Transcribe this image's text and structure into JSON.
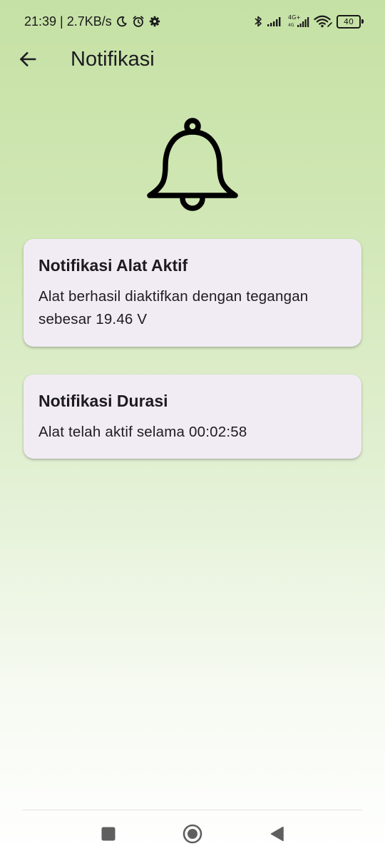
{
  "status_bar": {
    "time_speed": "21:39 | 2.7KB/s",
    "network_label_top": "4G+",
    "network_label_bottom": "4G",
    "battery_level": "40",
    "icons": [
      "moon-icon",
      "alarm-icon",
      "settings-icon",
      "bluetooth-icon",
      "signal-icon",
      "signal-icon",
      "wifi-icon",
      "battery-icon"
    ]
  },
  "app_bar": {
    "title": "Notifikasi",
    "back_icon": "arrow-left-icon"
  },
  "header_icon": "bell-icon",
  "notifications": [
    {
      "title": "Notifikasi Alat Aktif",
      "body": "Alat berhasil diaktifkan dengan tegangan sebesar 19.46 V"
    },
    {
      "title": "Notifikasi Durasi",
      "body": "Alat telah aktif selama 00:02:58"
    }
  ],
  "nav_bar": {
    "icons": [
      "recents-icon",
      "home-icon",
      "back-icon"
    ]
  },
  "colors": {
    "gradient_top": "#c5e1a5",
    "gradient_bottom": "#ffffff",
    "card_background": "#f1ecf4",
    "text": "#1d1b20"
  }
}
